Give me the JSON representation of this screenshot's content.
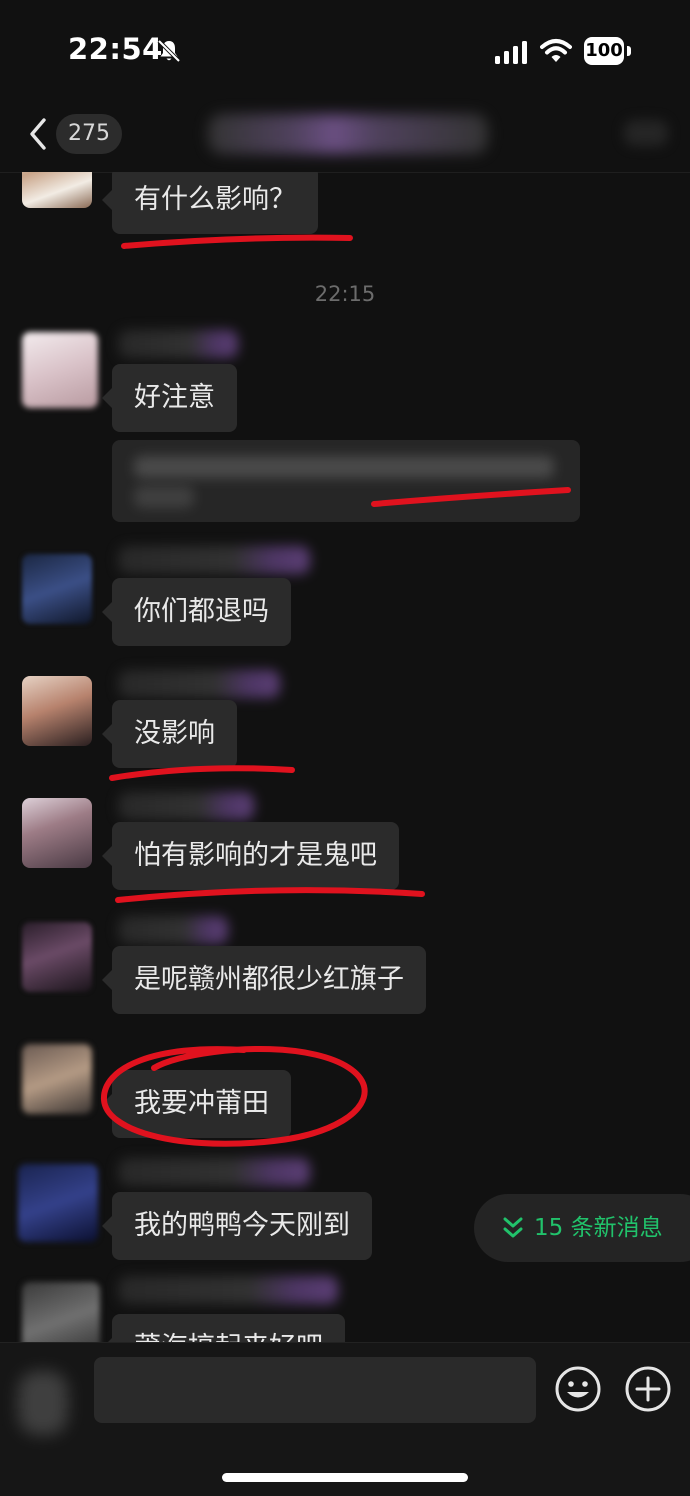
{
  "status_bar": {
    "time": "22:54",
    "battery": "100"
  },
  "nav": {
    "unread_count": "275"
  },
  "chat": {
    "timestamp": "22:15",
    "messages": [
      {
        "text": "有什么影响？"
      },
      {
        "text": "好注意"
      },
      {
        "text": "你们都退吗"
      },
      {
        "text": "没影响"
      },
      {
        "text": "怕有影响的才是鬼吧"
      },
      {
        "text": "是呢赣州都很少红旗子"
      },
      {
        "text": "我要冲莆田"
      },
      {
        "text": "我的鸭鸭今天刚到"
      },
      {
        "text": "莆海搞起来好吧"
      }
    ],
    "annotation_color": "#e0121e"
  },
  "new_messages": {
    "label": "15 条新消息",
    "color": "#21c26b"
  },
  "input": {
    "value": ""
  }
}
